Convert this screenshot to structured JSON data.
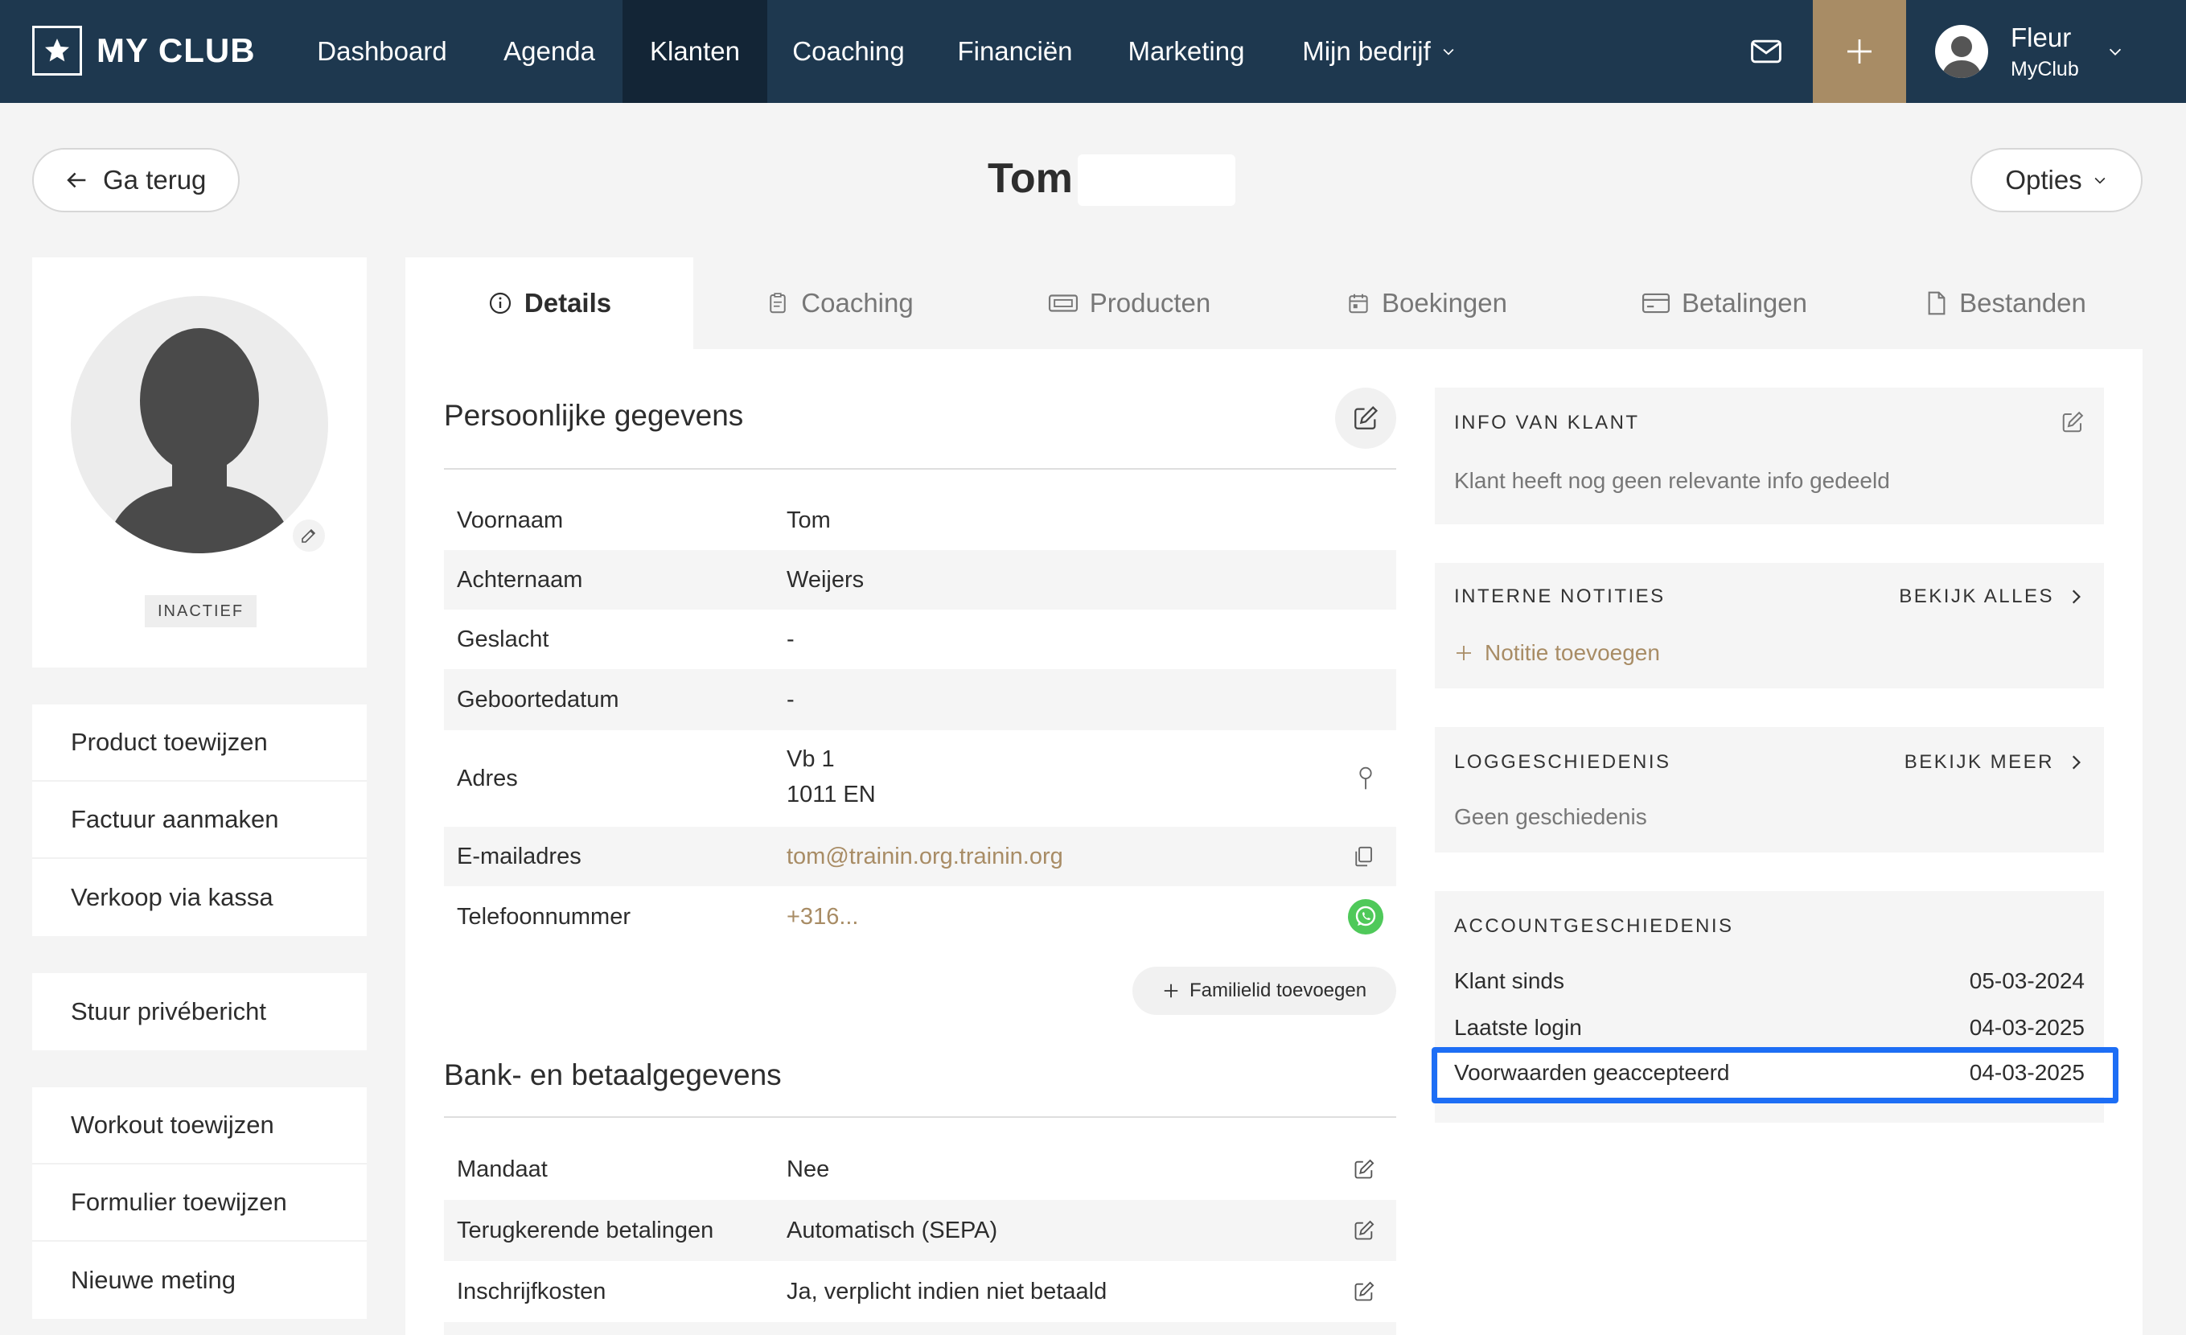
{
  "app": {
    "logo_text": "MY CLUB"
  },
  "nav": {
    "items": [
      {
        "label": "Dashboard"
      },
      {
        "label": "Agenda"
      },
      {
        "label": "Klanten",
        "active": true
      },
      {
        "label": "Coaching"
      },
      {
        "label": "Financiën"
      },
      {
        "label": "Marketing"
      },
      {
        "label": "Mijn bedrijf"
      }
    ]
  },
  "user": {
    "name": "Fleur",
    "org": "MyClub"
  },
  "header": {
    "back_label": "Ga terug",
    "title": "Tom",
    "options_label": "Opties"
  },
  "profile": {
    "status": "INACTIEF"
  },
  "actions": {
    "group1": [
      "Product toewijzen",
      "Factuur aanmaken",
      "Verkoop via kassa"
    ],
    "group2": [
      "Stuur privébericht"
    ],
    "group3": [
      "Workout toewijzen",
      "Formulier toewijzen",
      "Nieuwe meting"
    ]
  },
  "tabs": [
    {
      "label": "Details",
      "icon": "info-icon",
      "active": true
    },
    {
      "label": "Coaching",
      "icon": "clipboard-icon"
    },
    {
      "label": "Producten",
      "icon": "ticket-icon"
    },
    {
      "label": "Boekingen",
      "icon": "calendar-icon"
    },
    {
      "label": "Betalingen",
      "icon": "credit-card-icon"
    },
    {
      "label": "Bestanden",
      "icon": "file-icon"
    }
  ],
  "personal": {
    "title": "Persoonlijke gegevens",
    "rows": [
      {
        "label": "Voornaam",
        "value": "Tom"
      },
      {
        "label": "Achternaam",
        "value": "Weijers"
      },
      {
        "label": "Geslacht",
        "value": "-"
      },
      {
        "label": "Geboortedatum",
        "value": "-"
      },
      {
        "label": "Adres",
        "value": "Vb 1",
        "value2": "1011 EN"
      },
      {
        "label": "E-mailadres",
        "value": "tom@trainin.org.trainin.org"
      },
      {
        "label": "Telefoonnummer",
        "value": "+316..."
      }
    ],
    "family_button": "Familielid toevoegen"
  },
  "bank": {
    "title": "Bank- en betaalgegevens",
    "rows": [
      {
        "label": "Mandaat",
        "value": "Nee"
      },
      {
        "label": "Terugkerende betalingen",
        "value": "Automatisch (SEPA)"
      },
      {
        "label": "Inschrijfkosten",
        "value": "Ja, verplicht indien niet betaald"
      }
    ]
  },
  "info_card": {
    "title": "INFO VAN KLANT",
    "text": "Klant heeft nog geen relevante info gedeeld"
  },
  "notes_card": {
    "title": "INTERNE NOTITIES",
    "link": "BEKIJK ALLES",
    "add_label": "Notitie toevoegen"
  },
  "log_card": {
    "title": "LOGGESCHIEDENIS",
    "link": "BEKIJK MEER",
    "text": "Geen geschiedenis"
  },
  "account_card": {
    "title": "ACCOUNTGESCHIEDENIS",
    "rows": [
      {
        "label": "Klant sinds",
        "value": "05-03-2024"
      },
      {
        "label": "Laatste login",
        "value": "04-03-2025"
      },
      {
        "label": "Voorwaarden geaccepteerd",
        "value": "04-03-2025"
      }
    ]
  },
  "colors": {
    "nav_bg": "#1e384f",
    "nav_active": "#132536",
    "accent": "#a88c65",
    "highlight": "#1d6ef5",
    "whatsapp": "#4fc95a"
  }
}
